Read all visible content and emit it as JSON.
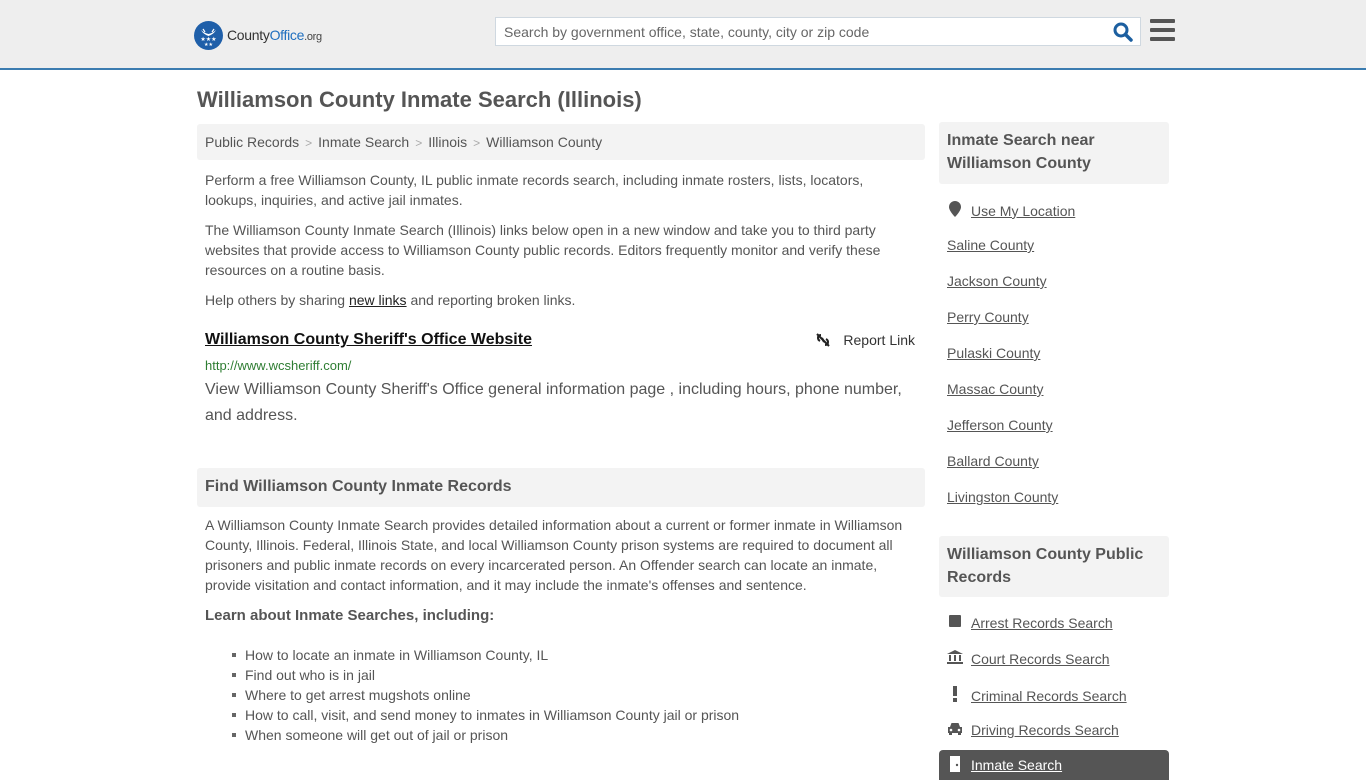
{
  "header": {
    "logo": {
      "county": "County",
      "office": "Office",
      "org": ".org"
    },
    "search_placeholder": "Search by government office, state, county, city or zip code",
    "search_icon": "search-icon",
    "menu_icon": "hamburger-menu-icon",
    "accent_color": "#3b7cb0"
  },
  "page": {
    "title": "Williamson County Inmate Search (Illinois)"
  },
  "breadcrumb": [
    "Public Records",
    "Inmate Search",
    "Illinois",
    "Williamson County"
  ],
  "intro": {
    "p1": "Perform a free Williamson County, IL public inmate records search, including inmate rosters, lists, locators, lookups, inquiries, and active jail inmates.",
    "p2": "The Williamson County Inmate Search (Illinois) links below open in a new window and take you to third party websites that provide access to Williamson County public records. Editors frequently monitor and verify these resources on a routine basis.",
    "p3_before": "Help others by sharing ",
    "p3_link": "new links",
    "p3_after": " and reporting broken links."
  },
  "result": {
    "title": "Williamson County Sheriff's Office Website",
    "report_label": "Report Link",
    "url": "http://www.wcsheriff.com/",
    "description": "View Williamson County Sheriff's Office general information page , including hours, phone number, and address."
  },
  "find_section": {
    "heading": "Find Williamson County Inmate Records",
    "body": "A Williamson County Inmate Search provides detailed information about a current or former inmate in Williamson County, Illinois. Federal, Illinois State, and local Williamson County prison systems are required to document all prisoners and public inmate records on every incarcerated person. An Offender search can locate an inmate, provide visitation and contact information, and it may include the inmate's offenses and sentence.",
    "learn_heading": "Learn about Inmate Searches, including:",
    "bullets": [
      "How to locate an inmate in Williamson County, IL",
      "Find out who is in jail",
      "Where to get arrest mugshots online",
      "How to call, visit, and send money to inmates in Williamson County jail or prison",
      "When someone will get out of jail or prison"
    ]
  },
  "sidebar": {
    "near_heading": "Inmate Search near Williamson County",
    "use_location": "Use My Location",
    "nearby": [
      "Saline County",
      "Jackson County",
      "Perry County",
      "Pulaski County",
      "Massac County",
      "Jefferson County",
      "Ballard County",
      "Livingston County"
    ],
    "records_heading": "Williamson County Public Records",
    "records": [
      {
        "label": "Arrest Records Search",
        "icon": "square-icon"
      },
      {
        "label": "Court Records Search",
        "icon": "courthouse-icon"
      },
      {
        "label": "Criminal Records Search",
        "icon": "exclamation-icon"
      },
      {
        "label": "Driving Records Search",
        "icon": "car-icon"
      }
    ],
    "active_record": {
      "label": "Inmate Search",
      "icon": "door-icon"
    }
  }
}
